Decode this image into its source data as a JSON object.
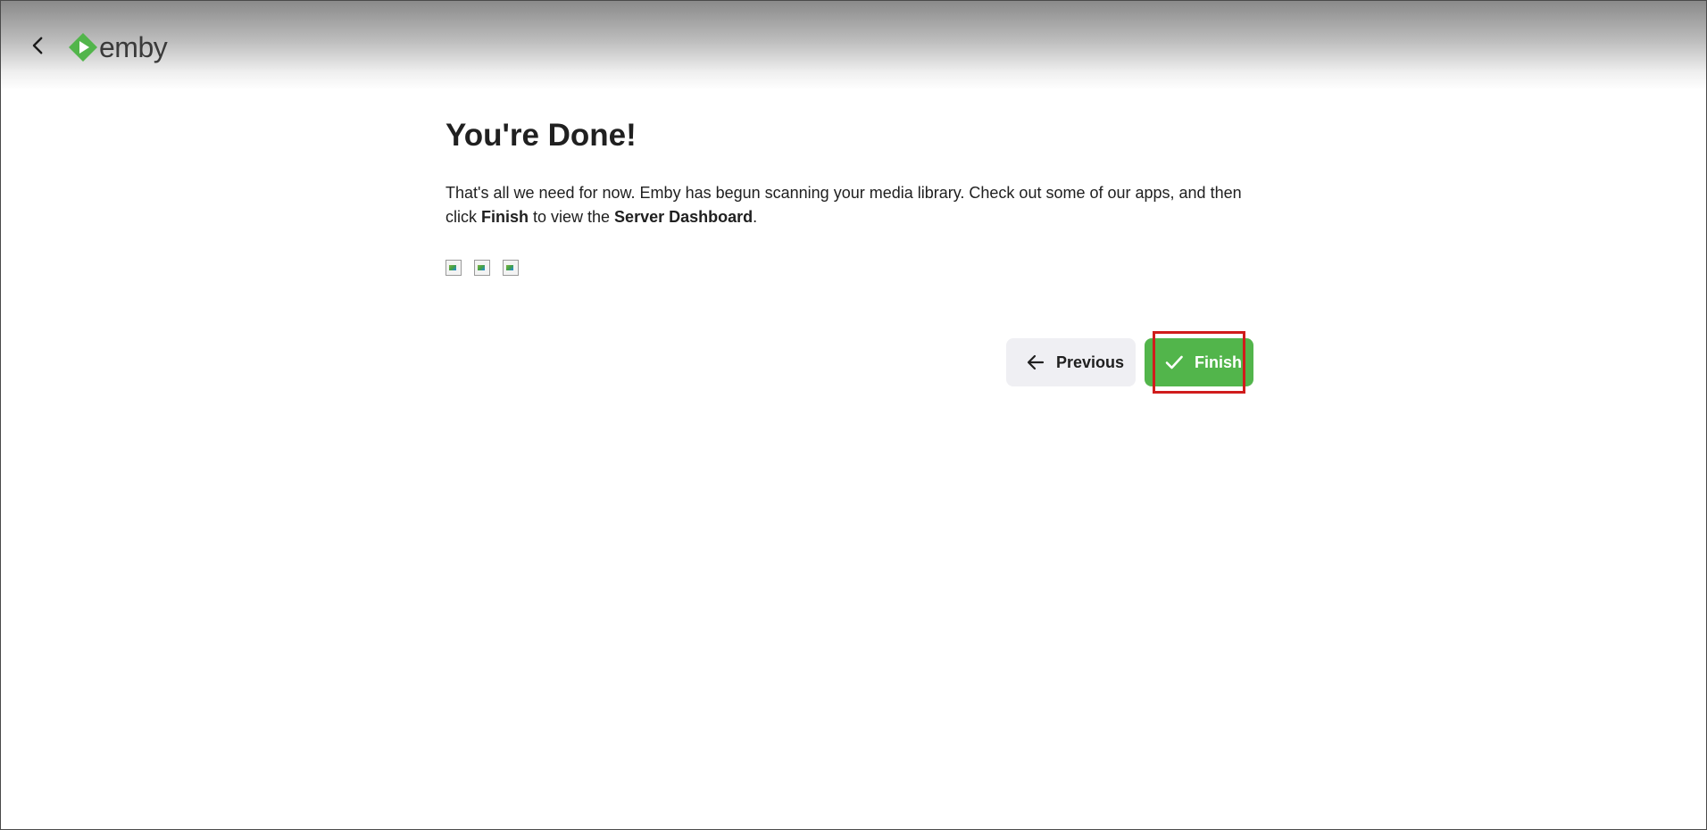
{
  "header": {
    "back_icon": "chevron-left-icon",
    "logo_text": "emby",
    "logo_icon": "emby-play-diamond-icon",
    "brand_color": "#52b54b"
  },
  "main": {
    "title": "You're Done!",
    "description_part1": "That's all we need for now. Emby has begun scanning your media library. Check out some of our apps, and then click ",
    "description_bold1": "Finish",
    "description_part2": " to view the ",
    "description_bold2": "Server Dashboard",
    "description_part3": ".",
    "app_icons": [
      "broken-image-icon",
      "broken-image-icon",
      "broken-image-icon"
    ]
  },
  "buttons": {
    "previous_label": "Previous",
    "previous_icon": "arrow-left-icon",
    "finish_label": "Finish",
    "finish_icon": "check-icon",
    "finish_color": "#52b54b",
    "previous_bg": "#efeff3"
  },
  "annotation": {
    "highlight_color": "#d01c1c"
  }
}
